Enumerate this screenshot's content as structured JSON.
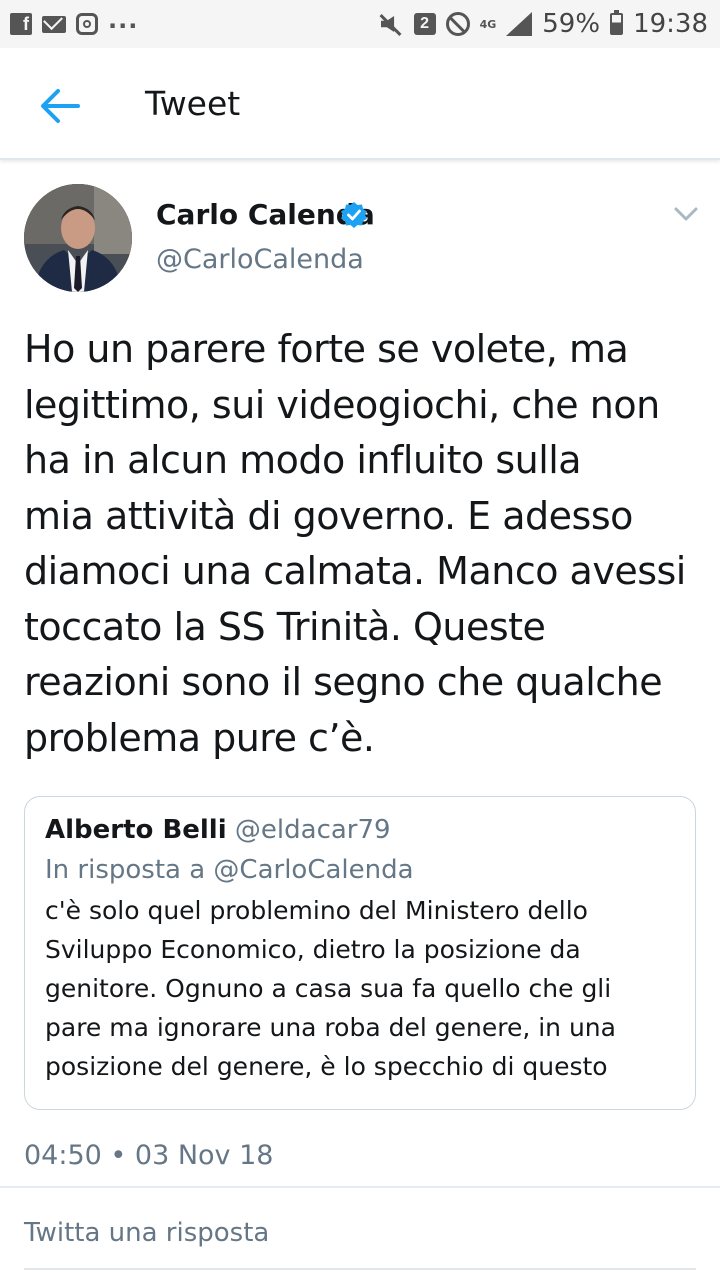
{
  "status_bar": {
    "notifications_count": "2",
    "network": "4G",
    "battery": "59%",
    "time": "19:38"
  },
  "header": {
    "title": "Tweet"
  },
  "tweet": {
    "author_name": "Carlo Calenda",
    "handle": "@CarloCalenda",
    "verified": true,
    "text": "Ho un parere forte se volete, ma\nlegittimo, sui videogiochi, che non\nha in alcun modo influito sulla\nmia attività di governo. E adesso\ndiamoci una calmata. Manco avessi\ntoccato la SS Trinità. Queste\nreazioni sono il segno che qualche\nproblema pure c’è.",
    "timestamp": "04:50 • 03 Nov 18"
  },
  "quoted_tweet": {
    "author_name": "Alberto Belli",
    "handle": "@eldacar79",
    "reply_to": "In risposta a @CarloCalenda",
    "text": "c'è solo quel problemino del Ministero dello Sviluppo Economico, dietro la posizione da genitore. Ognuno a casa sua fa quello che gli pare ma ignorare una roba del genere, in una posizione del genere, è lo specchio di questo paese sfasciat..."
  },
  "reply": {
    "placeholder": "Twitta una risposta"
  },
  "colors": {
    "accent": "#1da1f2",
    "secondary_text": "#657786"
  }
}
